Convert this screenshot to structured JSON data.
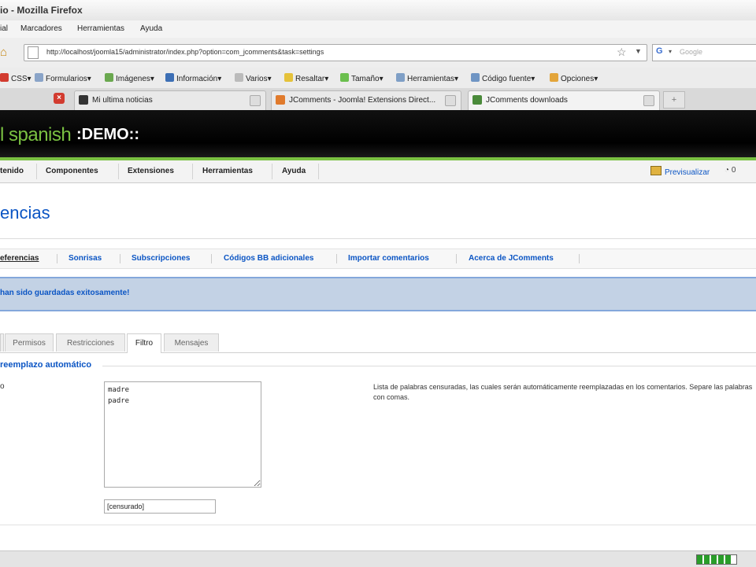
{
  "browser": {
    "title": "io - Mozilla Firefox",
    "menu": [
      "ial",
      "Marcadores",
      "Herramientas",
      "Ayuda"
    ],
    "url": "http://localhost/joomla15/administrator/index.php?option=com_jcomments&task=settings",
    "search_placeholder": "Google",
    "toolbar": [
      {
        "label": "CSS▾",
        "color": "#d23b2f"
      },
      {
        "label": "Formularios▾",
        "color": "#8aa4c8"
      },
      {
        "label": "Imágenes▾",
        "color": "#6aa84f"
      },
      {
        "label": "Información▾",
        "color": "#3d6fb5"
      },
      {
        "label": "Varios▾",
        "color": "#bbbbbb"
      },
      {
        "label": "Resaltar▾",
        "color": "#e5c23a"
      },
      {
        "label": "Tamaño▾",
        "color": "#6bbf4e"
      },
      {
        "label": "Herramientas▾",
        "color": "#7f9fc6"
      },
      {
        "label": "Código fuente▾",
        "color": "#6f95c4"
      },
      {
        "label": "Opciones▾",
        "color": "#e3a53a"
      }
    ],
    "tabs": [
      {
        "label": "Mi ultima noticias",
        "fav_color": "#333333"
      },
      {
        "label": "JComments - Joomla! Extensions Direct...",
        "fav_color": "#e07a2c"
      },
      {
        "label": "JComments downloads",
        "fav_color": "#4a8a3a"
      }
    ],
    "new_tab_symbol": "+"
  },
  "joomla": {
    "brand": "l spanish",
    "demo": ":DEMO::",
    "menu": [
      "tenido",
      "Componentes",
      "Extensiones",
      "Herramientas",
      "Ayuda"
    ],
    "preview_label": "Previsualizar",
    "messages_count": "0",
    "page_title": "encias",
    "subnav": [
      "eferencias",
      "Sonrisas",
      "Subscripciones",
      "Códigos BB adicionales",
      "Importar comentarios",
      "Acerca de JComments"
    ],
    "message": "han sido guardadas exitosamente!",
    "inner_tabs": [
      "",
      "Permisos",
      "Restricciones",
      "Filtro",
      "Mensajes"
    ],
    "legend": "reemplazo automático",
    "row_label": "o",
    "censored_words": "madre\npadre",
    "description": "Lista de palabras censuradas, las cuales serán automáticamente reemplazadas en los comentarios. Separe las palabras con comas.",
    "replacement": "[censurado]"
  }
}
